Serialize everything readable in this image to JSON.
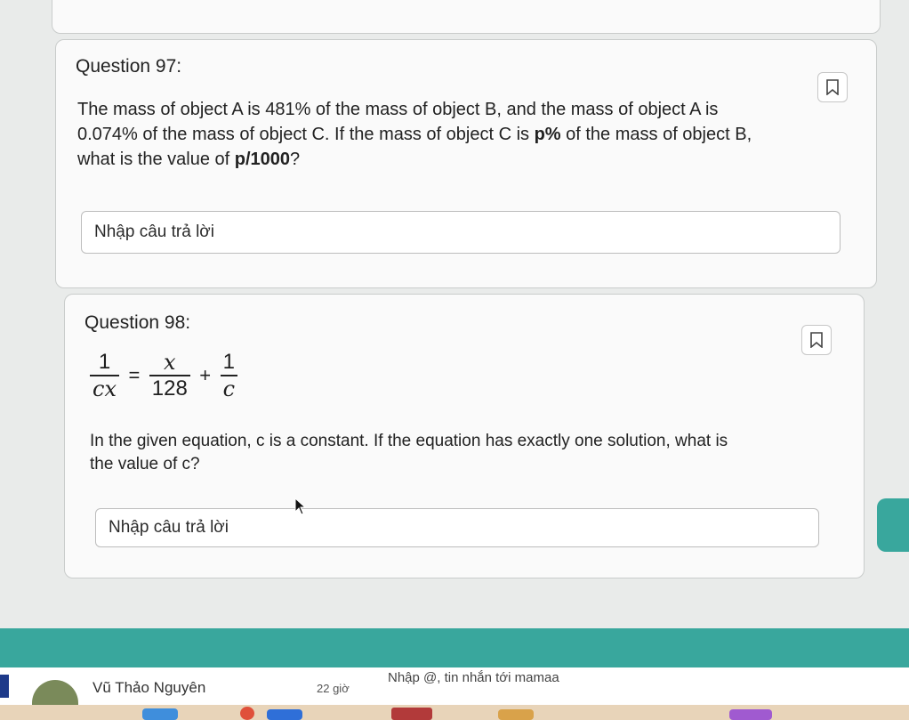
{
  "q97": {
    "title": "Question 97:",
    "line1": "The mass of object A is 481% of the mass of object B, and the mass of object A is",
    "line2a": "0.074% of the mass of object C. If the mass of object C is ",
    "line2b": "p%",
    "line2c": " of the mass of object B,",
    "line3a": "what is the value of ",
    "line3b": "p/1000",
    "line3c": "?",
    "answer_placeholder": "Nhập câu trả lời"
  },
  "q98": {
    "title": "Question 98:",
    "eq": {
      "l_num": "1",
      "l_den": "cx",
      "eq_sign": "=",
      "m_num": "x",
      "m_den": "128",
      "plus": "+",
      "r_num": "1",
      "r_den": "c"
    },
    "line1": "In the given equation, c is a constant. If the equation has exactly one solution, what is",
    "line2": "the value of c?",
    "answer_placeholder": "Nhập câu trả lời"
  },
  "chat": {
    "name": "Vũ Thảo Nguyên",
    "time": "22 giờ",
    "input_placeholder": "Nhập @, tin nhắn tới mamaa"
  },
  "colors": {
    "accent": "#39a79d",
    "card_bg": "#fafafa",
    "page_bg": "#e9ebea"
  }
}
